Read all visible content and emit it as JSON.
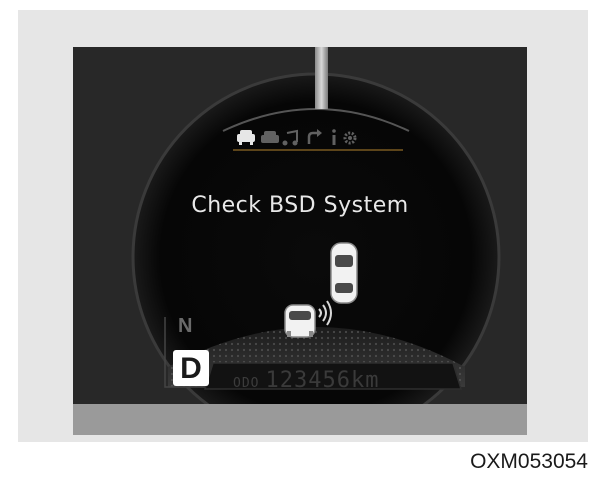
{
  "cluster": {
    "message": "Check BSD System",
    "gear_current": "D",
    "gear_previous": "N",
    "odometer_label": "ODO",
    "odometer_value": "123456km",
    "menu_icons": [
      "car-assist-icon",
      "car-settings-icon",
      "music-note-icon",
      "turn-arrow-icon",
      "info-icon",
      "gear-icon"
    ]
  },
  "figure": {
    "code": "OXM053054"
  },
  "colors": {
    "screen_bg": "#282828",
    "frame_bg": "#e6e6e6",
    "text_light": "#e8e8e8"
  }
}
